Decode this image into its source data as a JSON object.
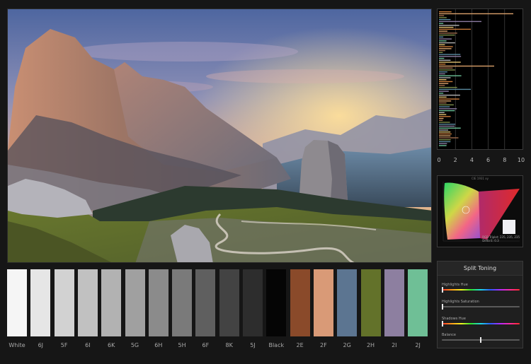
{
  "photo": {
    "subject": "landscape-photo",
    "colors": {
      "sky_top": "#5f76a8",
      "sky_mid": "#b99fae",
      "sun_glow": "#f5c15a",
      "rock_lit": "#c98f73",
      "rock_shade": "#5c5a63",
      "grass": "#5c6a2a"
    }
  },
  "swatches": [
    {
      "label": "White",
      "color": "#f5f5f5"
    },
    {
      "label": "6J",
      "color": "#e6e6e6"
    },
    {
      "label": "5F",
      "color": "#d2d2d2"
    },
    {
      "label": "6I",
      "color": "#c1c1c1"
    },
    {
      "label": "6K",
      "color": "#b2b2b2"
    },
    {
      "label": "5G",
      "color": "#a0a0a0"
    },
    {
      "label": "6H",
      "color": "#8b8b8b"
    },
    {
      "label": "5H",
      "color": "#7a7a7a"
    },
    {
      "label": "6F",
      "color": "#5f5f5f"
    },
    {
      "label": "8K",
      "color": "#434343"
    },
    {
      "label": "5J",
      "color": "#2d2d2d"
    },
    {
      "label": "Black",
      "color": "#050505"
    },
    {
      "label": "2E",
      "color": "#8a4a2a"
    },
    {
      "label": "2F",
      "color": "#d99a77"
    },
    {
      "label": "2G",
      "color": "#5c7591"
    },
    {
      "label": "2H",
      "color": "#63722a"
    },
    {
      "label": "2I",
      "color": "#8d7fa0"
    },
    {
      "label": "2J",
      "color": "#6fbf96"
    }
  ],
  "histogram": {
    "ticks": [
      "0",
      "2",
      "4",
      "6",
      "8",
      "10"
    ]
  },
  "gamut": {
    "title": "CIE 1931 xy",
    "info_line1": "RGB Triplet: 235, 235, 235",
    "info_line2": "Delta E: 0.3"
  },
  "split_toning": {
    "title": "Split Toning",
    "highlights_hue": {
      "label": "Highlights Hue",
      "value": 0.0
    },
    "highlights_saturation": {
      "label": "Highlights Saturation",
      "value": 0.0
    },
    "shadows_hue": {
      "label": "Shadows Hue",
      "value": 0.0
    },
    "balance": {
      "label": "Balance",
      "value": 0.5
    }
  }
}
